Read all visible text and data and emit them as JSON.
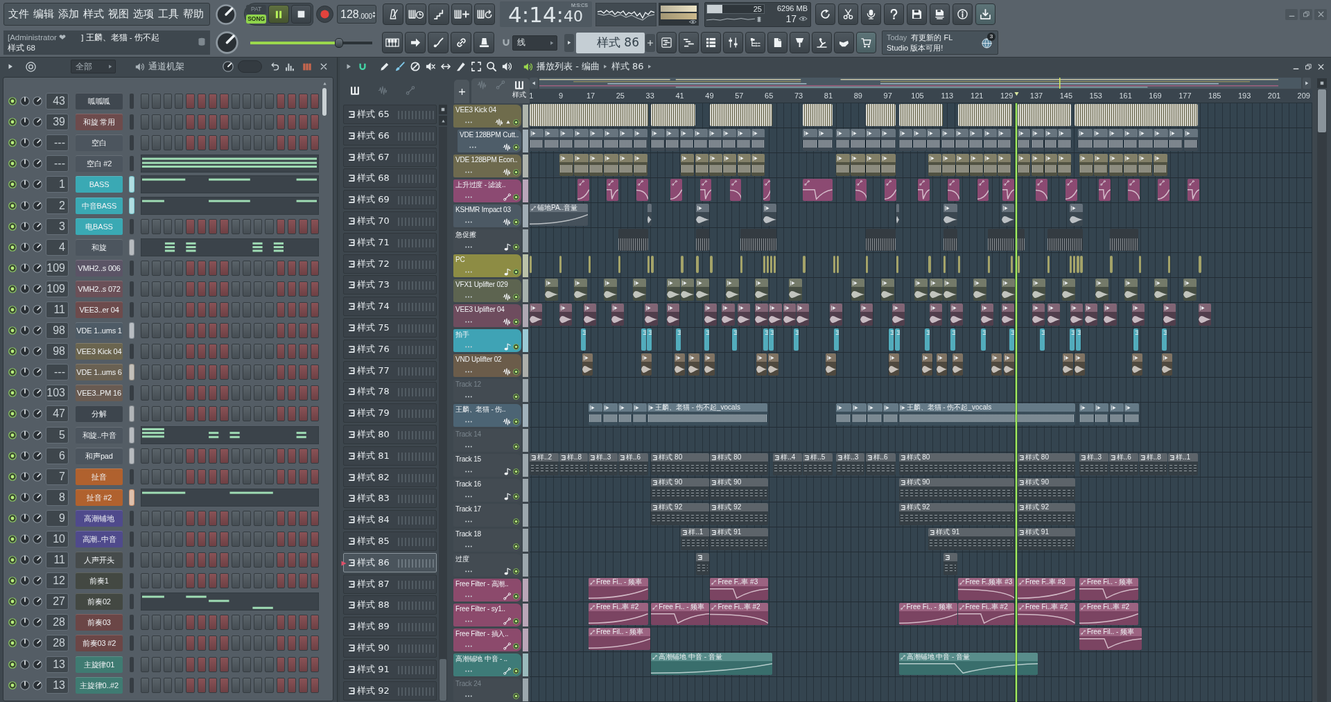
{
  "menu": [
    "文件",
    "编辑",
    "添加",
    "样式",
    "视图",
    "选项",
    "工具",
    "帮助"
  ],
  "hint": {
    "user": "[Administrator ❤",
    "song": "] 王麟、老猫 - 伤不起",
    "message": "样式 68"
  },
  "transport": {
    "modes": [
      {
        "label": "PAT",
        "selected": false
      },
      {
        "label": "SONG",
        "selected": true
      }
    ],
    "playing": true,
    "tempo": "128",
    "tempo_fraction": ".000"
  },
  "master_volume": {
    "level": 0.73
  },
  "time": {
    "main": "4:14:",
    "centiseconds": "40",
    "format": "M:S:CS"
  },
  "output_meter": {
    "level": 1
  },
  "cpu": {
    "level": 0.27,
    "reading": "25",
    "memory": "6296 MB",
    "polyphony": "17"
  },
  "snap": {
    "value": "线"
  },
  "pattern_selector": {
    "value": "样式 86"
  },
  "news": {
    "day": "Today",
    "line_1": "有更新的 FL",
    "line_2": "Studio 版本可用!",
    "badge": "3"
  },
  "channel_rack": {
    "filter": "全部",
    "title": "通道机架",
    "channels": [
      {
        "number": "43",
        "name": "呱呱呱",
        "color": "#3f474f",
        "selected": false,
        "kind": "steps"
      },
      {
        "number": "39",
        "name": "和旋 常用",
        "color": "#6d4b4c",
        "selected": false,
        "kind": "steps"
      },
      {
        "number": "---",
        "name": "空白",
        "color": "#4c555e",
        "selected": false,
        "kind": "steps"
      },
      {
        "number": "---",
        "name": "空白 #2",
        "color": "#4c555e",
        "selected": false,
        "kind": "piano-roll"
      },
      {
        "number": "1",
        "name": "BASS",
        "color": "#3aa9b4",
        "selected": true,
        "kind": "piano-roll"
      },
      {
        "number": "2",
        "name": "中音BASS",
        "color": "#3aa9b4",
        "selected": true,
        "kind": "piano-roll"
      },
      {
        "number": "3",
        "name": "电BASS",
        "color": "#3aa9b4",
        "selected": false,
        "kind": "steps"
      },
      {
        "number": "4",
        "name": "和旋",
        "color": "#4c555e",
        "selected": true,
        "kind": "piano-roll"
      },
      {
        "number": "109",
        "name": "VMH2..s 006",
        "color": "#5b5466",
        "selected": false,
        "kind": "steps"
      },
      {
        "number": "109",
        "name": "VMH2..s 072",
        "color": "#6b5058",
        "selected": false,
        "kind": "steps"
      },
      {
        "number": "11",
        "name": "VEE3..er 04",
        "color": "#6d4b4c",
        "selected": false,
        "kind": "steps"
      },
      {
        "number": "98",
        "name": "VDE 1..ums 1",
        "color": "#4e5b66",
        "selected": true,
        "kind": "steps"
      },
      {
        "number": "98",
        "name": "VEE3 Kick 04",
        "color": "#6b654f",
        "selected": false,
        "kind": "steps"
      },
      {
        "number": "---",
        "name": "VDE 1..ums 6",
        "color": "#6a6152",
        "selected": true,
        "kind": "steps"
      },
      {
        "number": "103",
        "name": "VEE3..PM 16",
        "color": "#695b52",
        "selected": false,
        "kind": "steps"
      },
      {
        "number": "47",
        "name": "分解",
        "color": "#3d454d",
        "selected": true,
        "kind": "steps"
      },
      {
        "number": "5",
        "name": "和旋..中音",
        "color": "#4c555e",
        "selected": true,
        "kind": "piano-roll"
      },
      {
        "number": "6",
        "name": "和声pad",
        "color": "#4c555e",
        "selected": true,
        "kind": "steps"
      },
      {
        "number": "7",
        "name": "扯音",
        "color": "#b0612e",
        "selected": false,
        "kind": "steps"
      },
      {
        "number": "8",
        "name": "扯音 #2",
        "color": "#b0612e",
        "selected": true,
        "kind": "piano-roll"
      },
      {
        "number": "9",
        "name": "高潮铺地",
        "color": "#4f4a8c",
        "selected": false,
        "kind": "steps"
      },
      {
        "number": "10",
        "name": "高潮..中音",
        "color": "#4f4a8c",
        "selected": false,
        "kind": "steps"
      },
      {
        "number": "11",
        "name": "人声开头",
        "color": "#464b4b",
        "selected": false,
        "kind": "steps"
      },
      {
        "number": "12",
        "name": "前奏1",
        "color": "#434842",
        "selected": false,
        "kind": "steps"
      },
      {
        "number": "27",
        "name": "前奏02",
        "color": "#434842",
        "selected": false,
        "kind": "piano-roll"
      },
      {
        "number": "28",
        "name": "前奏03",
        "color": "#6b4646",
        "selected": false,
        "kind": "steps"
      },
      {
        "number": "28",
        "name": "前奏03 #2",
        "color": "#6b4646",
        "selected": false,
        "kind": "steps"
      },
      {
        "number": "13",
        "name": "主旋律01",
        "color": "#3f7b72",
        "selected": false,
        "kind": "steps"
      },
      {
        "number": "13",
        "name": "主旋律0..#2",
        "color": "#3f7b72",
        "selected": false,
        "kind": "steps"
      }
    ]
  },
  "pattern_list": {
    "filters": [
      {
        "kind": "pattern",
        "selected": true
      },
      {
        "kind": "audio",
        "selected": false
      },
      {
        "kind": "automation",
        "selected": false
      }
    ],
    "patterns": [
      {
        "name": "样式 65",
        "selected": false
      },
      {
        "name": "样式 66",
        "selected": false
      },
      {
        "name": "样式 67",
        "selected": false
      },
      {
        "name": "样式 68",
        "selected": false
      },
      {
        "name": "样式 69",
        "selected": false
      },
      {
        "name": "样式 70",
        "selected": false
      },
      {
        "name": "样式 71",
        "selected": false
      },
      {
        "name": "样式 72",
        "selected": false
      },
      {
        "name": "样式 73",
        "selected": false
      },
      {
        "name": "样式 74",
        "selected": false
      },
      {
        "name": "样式 75",
        "selected": false
      },
      {
        "name": "样式 76",
        "selected": false
      },
      {
        "name": "样式 77",
        "selected": false
      },
      {
        "name": "样式 78",
        "selected": false
      },
      {
        "name": "样式 79",
        "selected": false
      },
      {
        "name": "样式 80",
        "selected": false
      },
      {
        "name": "样式 81",
        "selected": false
      },
      {
        "name": "样式 82",
        "selected": false
      },
      {
        "name": "样式 83",
        "selected": false
      },
      {
        "name": "样式 84",
        "selected": false
      },
      {
        "name": "样式 85",
        "selected": false
      },
      {
        "name": "样式 86",
        "selected": true
      },
      {
        "name": "样式 87",
        "selected": false
      },
      {
        "name": "样式 88",
        "selected": false
      },
      {
        "name": "样式 89",
        "selected": false
      },
      {
        "name": "样式 90",
        "selected": false
      },
      {
        "name": "样式 91",
        "selected": false
      },
      {
        "name": "样式 92",
        "selected": false
      }
    ]
  },
  "playlist": {
    "title": "播放列表 - 编曲",
    "pattern": "样式 86",
    "filters": [
      {
        "kind": "audio",
        "selected": false
      },
      {
        "kind": "automation",
        "selected": false
      },
      {
        "kind": "pattern",
        "selected": true,
        "label": "样式"
      }
    ],
    "ruler": [
      "1",
      "9",
      "17",
      "25",
      "33",
      "41",
      "49",
      "57",
      "65",
      "73",
      "81",
      "89",
      "97",
      "105",
      "113",
      "121",
      "129",
      "137",
      "145",
      "153",
      "161",
      "169",
      "177",
      "185",
      "193",
      "201",
      "209"
    ],
    "tracks": [
      {
        "name": "VEE3 Kick 04",
        "color": "#6f6c4c",
        "kind": "audio",
        "expanded": true,
        "children": [
          {
            "name": "VDE 128BPM Cutt..",
            "color": "#4e5d69",
            "kind": "audio"
          }
        ]
      },
      {
        "name": "VDE 128BPM Econ..",
        "color": "#6e6a4e",
        "kind": "audio"
      },
      {
        "name": "上升过度 - 滤波..",
        "color": "#8c4a72",
        "kind": "automation"
      },
      {
        "name": "KSHMR Impact 03",
        "color": "#4c5964",
        "kind": "audio",
        "clips": [
          {
            "kind": "automation",
            "label": "铺地PA..音量"
          }
        ]
      },
      {
        "name": "急促擦",
        "color": "#434b52",
        "kind": "pattern"
      },
      {
        "name": "PC",
        "color": "#8d8c44",
        "kind": "pattern"
      },
      {
        "name": "VFX1 Uplifter 029",
        "color": "#5d6450",
        "kind": "audio"
      },
      {
        "name": "VEE3 Uplifter 04",
        "color": "#6e4c5e",
        "kind": "audio"
      },
      {
        "name": "拍手",
        "color": "#3fa3b5",
        "kind": "pattern"
      },
      {
        "name": "VND Uplifter 02",
        "color": "#6b5c4a",
        "kind": "audio"
      },
      {
        "name": "Track 12",
        "color": "#434b52",
        "kind": "empty"
      },
      {
        "name": "王麟、老猫 - 伤..",
        "color": "#4c6474",
        "kind": "audio",
        "clips": [
          {
            "kind": "audio",
            "label": "王麟、老猫 - 伤不起_vocals"
          },
          {
            "kind": "audio",
            "label": "王麟、老猫 - 伤不起_vocals"
          }
        ]
      },
      {
        "name": "Track 14",
        "color": "#434b52",
        "kind": "empty"
      },
      {
        "name": "Track 15",
        "color": "#434b52",
        "kind": "pattern",
        "clips": [
          {
            "kind": "pattern",
            "label": "样..2"
          },
          {
            "kind": "pattern",
            "label": "样..8"
          },
          {
            "kind": "pattern",
            "label": "样..3"
          },
          {
            "kind": "pattern",
            "label": "样..6"
          },
          {
            "kind": "pattern",
            "label": "样式 80"
          },
          {
            "kind": "pattern",
            "label": "样式 80"
          },
          {
            "kind": "pattern",
            "label": "样..4"
          },
          {
            "kind": "pattern",
            "label": "样..5"
          },
          {
            "kind": "pattern",
            "label": "样..3"
          },
          {
            "kind": "pattern",
            "label": "样..6"
          },
          {
            "kind": "pattern",
            "label": "样式 80"
          },
          {
            "kind": "pattern",
            "label": "样式 80"
          },
          {
            "kind": "pattern",
            "label": "样..3"
          },
          {
            "kind": "pattern",
            "label": "样..6"
          },
          {
            "kind": "pattern",
            "label": "样..8"
          },
          {
            "kind": "pattern",
            "label": "样..1"
          }
        ]
      },
      {
        "name": "Track 16",
        "color": "#434b52",
        "kind": "pattern",
        "clips": [
          {
            "kind": "pattern",
            "label": "样式 90"
          },
          {
            "kind": "pattern",
            "label": "样式 90"
          },
          {
            "kind": "pattern",
            "label": "样式 90"
          },
          {
            "kind": "pattern",
            "label": "样式 90"
          }
        ]
      },
      {
        "name": "Track 17",
        "color": "#434b52",
        "kind": "plain",
        "clips": [
          {
            "kind": "pattern",
            "label": "样式 92"
          },
          {
            "kind": "pattern",
            "label": "样式 92"
          },
          {
            "kind": "pattern",
            "label": "样式 92"
          },
          {
            "kind": "pattern",
            "label": "样式 92"
          }
        ]
      },
      {
        "name": "Track 18",
        "color": "#434b52",
        "kind": "plain",
        "clips": [
          {
            "kind": "pattern",
            "label": "样..1"
          },
          {
            "kind": "pattern",
            "label": "样式 91"
          },
          {
            "kind": "pattern",
            "label": "样式 91"
          },
          {
            "kind": "pattern",
            "label": "样式 91"
          }
        ]
      },
      {
        "name": "过度",
        "color": "#434b52",
        "kind": "pattern"
      },
      {
        "name": "Free Filter - 高潮..",
        "color": "#8c4a6c",
        "kind": "automation",
        "clips": [
          {
            "kind": "automation",
            "label": "Free Fi.. - 频率"
          },
          {
            "kind": "automation",
            "label": "Free F..率 #3"
          },
          {
            "kind": "automation",
            "label": "Free F..频率 #3"
          },
          {
            "kind": "automation",
            "label": "Free F..率 #3"
          },
          {
            "kind": "automation",
            "label": "Free Fi.. - 频率"
          }
        ]
      },
      {
        "name": "Free Filter - sy1..",
        "color": "#8c4a6c",
        "kind": "automation",
        "clips": [
          {
            "kind": "automation",
            "label": "Free Fi..率 #2"
          },
          {
            "kind": "automation",
            "label": "Free Fi.. - 频率"
          },
          {
            "kind": "automation",
            "label": "Free Fi..率 #2"
          },
          {
            "kind": "automation",
            "label": "Free Fi.. - 频率"
          },
          {
            "kind": "automation",
            "label": "Free Fi..率 #2"
          },
          {
            "kind": "automation",
            "label": "Free Fi..率 #2"
          },
          {
            "kind": "automation",
            "label": "Free Fi..率 #2"
          }
        ]
      },
      {
        "name": "Free Filter - 插入..",
        "color": "#8c4a6c",
        "kind": "automation",
        "clips": [
          {
            "kind": "automation",
            "label": "Free Fil.. - 频率"
          },
          {
            "kind": "automation",
            "label": "Free Fil.. - 频率"
          }
        ]
      },
      {
        "name": "高潮铺地 中音 - ..",
        "color": "#3e7b78",
        "kind": "automation",
        "clips": [
          {
            "kind": "automation",
            "label": "高潮铺地 中音 - 音量"
          },
          {
            "kind": "automation",
            "label": "高潮铺地 中音 - 音量"
          }
        ]
      },
      {
        "name": "Track 24",
        "color": "#434b52",
        "kind": "empty"
      }
    ]
  }
}
